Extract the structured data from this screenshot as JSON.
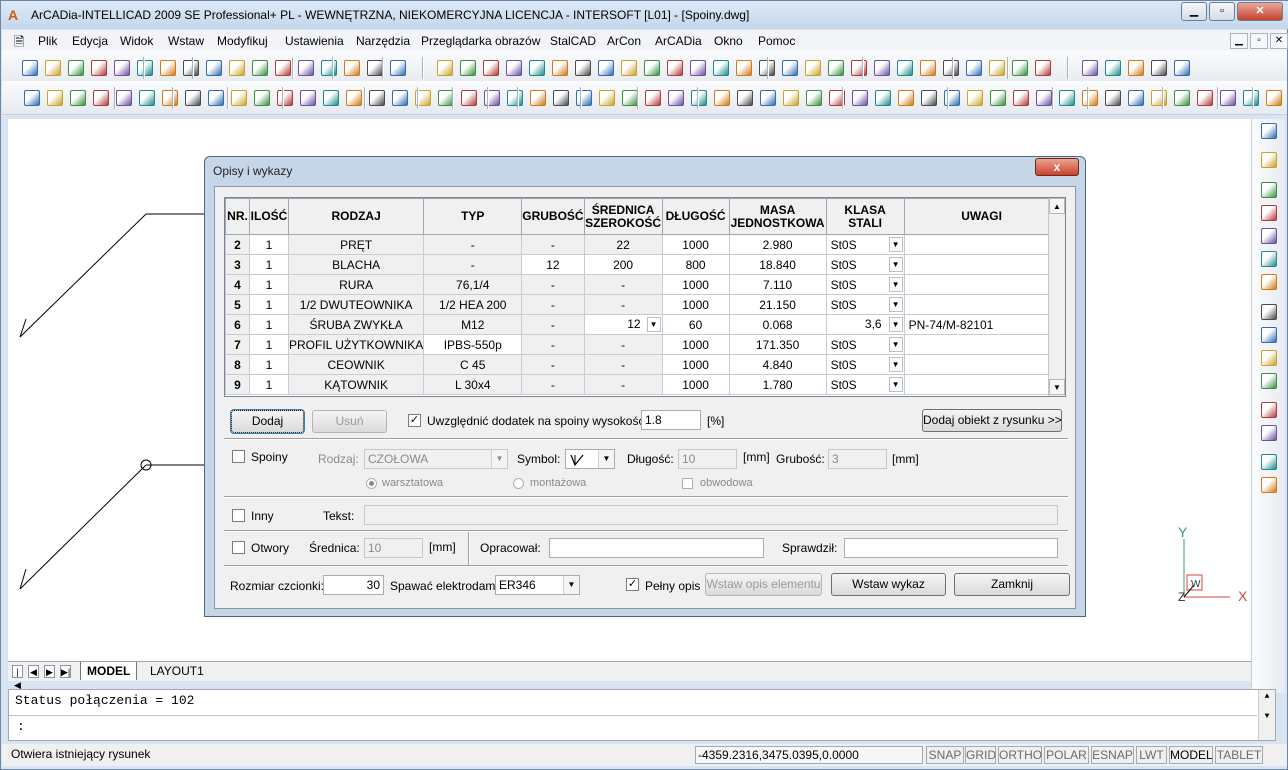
{
  "app": {
    "title": "ArCADia-INTELLICAD 2009 SE Professional+ PL - WEWNĘTRZNA, NIEKOMERCYJNA LICENCJA - INTERSOFT [L01] - [Spoiny.dwg]"
  },
  "menu": [
    "Plik",
    "Edycja",
    "Widok",
    "Wstaw",
    "Modyfikuj",
    "Ustawienia",
    "Narzędzia",
    "Przeglądarka obrazów",
    "StalCAD",
    "ArCon",
    "ArCADia",
    "Okno",
    "Pomoc"
  ],
  "layout_tabs": {
    "model": "MODEL",
    "layout1": "LAYOUT1"
  },
  "command": {
    "line1": "Status połączenia = 102",
    "prompt": ":"
  },
  "status": {
    "message": "Otwiera istniejący rysunek",
    "coords": "-4359.2316,3475.0395,0.0000",
    "buttons": [
      "SNAP",
      "GRID",
      "ORTHO",
      "POLAR",
      "ESNAP",
      "LWT",
      "MODEL",
      "TABLET"
    ]
  },
  "ucs": {
    "y": "Y",
    "x": "X",
    "z": "Z",
    "w": "W"
  },
  "dialog": {
    "title": "Opisy i wykazy",
    "close": "x",
    "columns": [
      "NR.",
      "ILOŚĆ",
      "RODZAJ",
      "TYP",
      "GRUBOŚĆ",
      "ŚREDNICA SZEROKOŚĆ",
      "DŁUGOŚĆ",
      "MASA JEDNOSTKOWA",
      "KLASA STALI",
      "UWAGI"
    ],
    "rows": [
      [
        "2",
        "1",
        "PRĘT",
        "-",
        "-",
        "22",
        "1000",
        "2.980",
        "St0S",
        ""
      ],
      [
        "3",
        "1",
        "BLACHA",
        "-",
        "12",
        "200",
        "800",
        "18.840",
        "St0S",
        ""
      ],
      [
        "4",
        "1",
        "RURA",
        "76,1/4",
        "-",
        "-",
        "1000",
        "7.110",
        "St0S",
        ""
      ],
      [
        "5",
        "1",
        "1/2 DWUTEOWNIKA",
        "1/2 HEA 200",
        "-",
        "-",
        "1000",
        "21.150",
        "St0S",
        ""
      ],
      [
        "6",
        "1",
        "ŚRUBA ZWYKŁA",
        "M12",
        "-",
        "12",
        "60",
        "0.068",
        "3,6",
        "PN-74/M-82101"
      ],
      [
        "7",
        "1",
        "PROFIL UŻYTKOWNIKA",
        "IPBS-550p",
        "-",
        "-",
        "1000",
        "171.350",
        "St0S",
        ""
      ],
      [
        "8",
        "1",
        "CEOWNIK",
        "C 45",
        "-",
        "-",
        "1000",
        "4.840",
        "St0S",
        ""
      ],
      [
        "9",
        "1",
        "KĄTOWNIK",
        "L 30x4",
        "-",
        "-",
        "1000",
        "1.780",
        "St0S",
        ""
      ]
    ],
    "dodaj": "Dodaj",
    "usun": "Usuń",
    "uwzglednic_label": "Uwzględnić dodatek na spoiny wysokości",
    "uwzglednic_checked": true,
    "dodatek_value": "1.8",
    "percent": "[%]",
    "dodaj_obiekt": "Dodaj obiekt z rysunku >>",
    "spoiny": {
      "label": "Spoiny",
      "rodzaj_label": "Rodzaj:",
      "rodzaj_value": "CZOŁOWA",
      "symbol_label": "Symbol:",
      "dlugosc_label": "Długość:",
      "dlugosc_value": "10",
      "mm1": "[mm]",
      "grubosc_label": "Grubość:",
      "grubosc_value": "3",
      "mm2": "[mm]",
      "warsztatowa": "warsztatowa",
      "montazowa": "montażowa",
      "obwodowa": "obwodowa"
    },
    "inny": {
      "label": "Inny",
      "tekst_label": "Tekst:"
    },
    "otwory": {
      "label": "Otwory",
      "srednica_label": "Średnica:",
      "srednica_value": "10",
      "mm": "[mm]",
      "opracowal_label": "Opracował:",
      "sprawdzil_label": "Sprawdził:"
    },
    "rozmiar_label": "Rozmiar czcionki:",
    "rozmiar_value": "30",
    "spawac_label": "Spawać elektrodami:",
    "spawac_value": "ER346",
    "pelny_opis_label": "Pełny opis",
    "pelny_opis_checked": true,
    "wstaw_opis": "Wstaw opis elementu",
    "wstaw_wykaz": "Wstaw wykaz",
    "zamknij": "Zamknij"
  }
}
